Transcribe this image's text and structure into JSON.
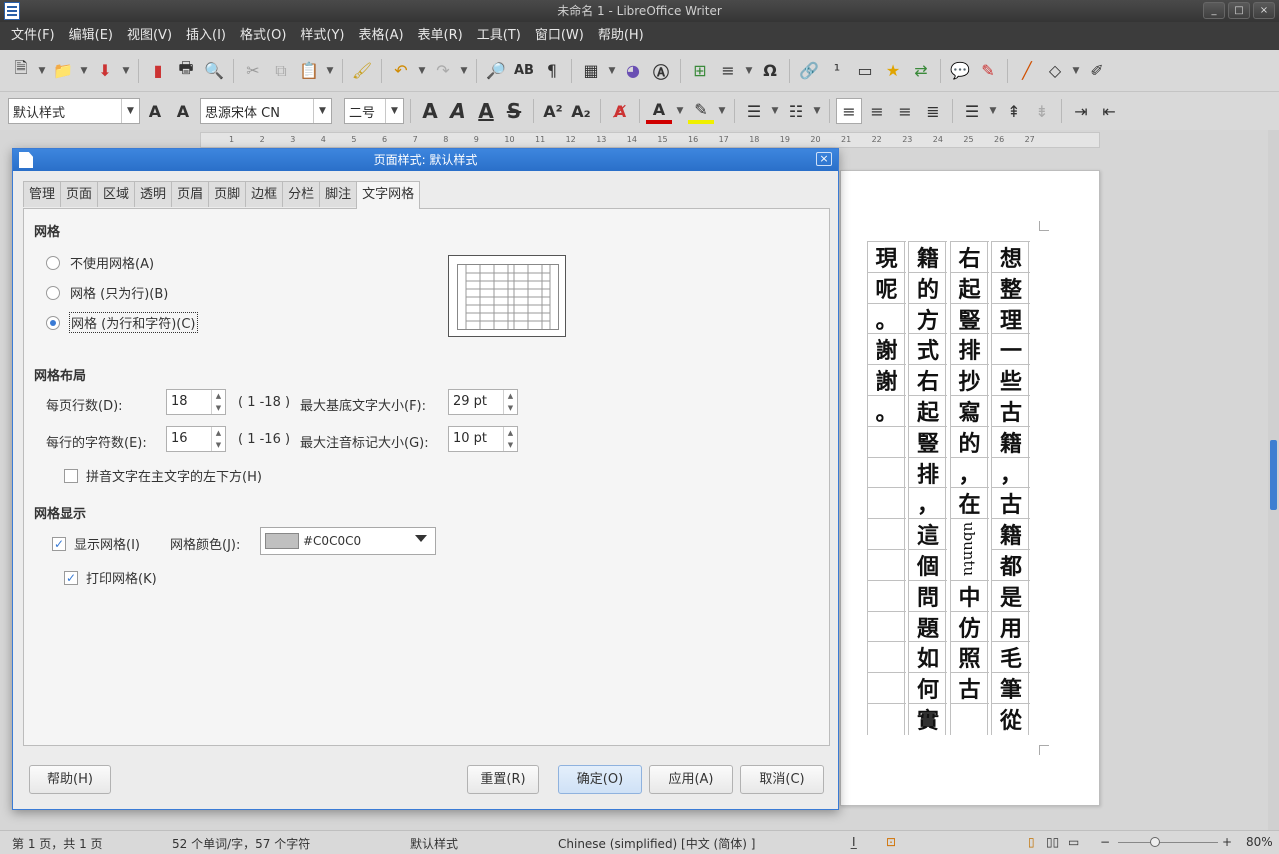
{
  "window": {
    "title": "未命名 1 - LibreOffice Writer",
    "controls": [
      "_",
      "□",
      "×"
    ]
  },
  "menubar": [
    "文件(F)",
    "编辑(E)",
    "视图(V)",
    "插入(I)",
    "格式(O)",
    "样式(Y)",
    "表格(A)",
    "表单(R)",
    "工具(T)",
    "窗口(W)",
    "帮助(H)"
  ],
  "formatbar": {
    "para_style": "默认样式",
    "font_name": "思源宋体 CN",
    "font_size": "二号"
  },
  "ruler_numbers": [
    "1",
    "2",
    "3",
    "4",
    "5",
    "6",
    "7",
    "8",
    "9",
    "10",
    "11",
    "12",
    "13",
    "14",
    "15",
    "16",
    "17",
    "18",
    "19",
    "20",
    "21",
    "22",
    "23",
    "24",
    "25",
    "26",
    "27"
  ],
  "document": {
    "columns": [
      [
        "想",
        "整",
        "理",
        "一",
        "些",
        "古",
        "籍",
        "，",
        "古",
        "籍",
        "都",
        "是",
        "用",
        "毛",
        "筆",
        "從"
      ],
      [
        "右",
        "起",
        "豎",
        "排",
        "抄",
        "寫",
        "的",
        "，",
        "在",
        "ubuntu",
        "中",
        "仿",
        "照",
        "古"
      ],
      [
        "籍",
        "的",
        "方",
        "式",
        "右",
        "起",
        "豎",
        "排",
        "，",
        "這",
        "個",
        "問",
        "題",
        "如",
        "何",
        "實"
      ],
      [
        "現",
        "呢",
        "。",
        "謝",
        "謝",
        "。"
      ]
    ]
  },
  "dialog": {
    "title": "页面样式: 默认样式",
    "close": "×",
    "tabs": [
      "管理",
      "页面",
      "区域",
      "透明",
      "页眉",
      "页脚",
      "边框",
      "分栏",
      "脚注",
      "文字网格"
    ],
    "active_tab": 9,
    "grid": {
      "section": "网格",
      "options": [
        "不使用网格(A)",
        "网格 (只为行)(B)",
        "网格 (为行和字符)(C)"
      ],
      "selected": 2
    },
    "layout": {
      "section": "网格布局",
      "lines_per_page_label": "每页行数(D):",
      "lines_per_page": "18",
      "lines_range": "( 1 -18 )",
      "max_base_size_label": "最大基底文字大小(F):",
      "max_base_size": "29 pt",
      "chars_per_line_label": "每行的字符数(E):",
      "chars_per_line": "16",
      "chars_range": "( 1 -16 )",
      "max_ruby_size_label": "最大注音标记大小(G):",
      "max_ruby_size": "10 pt",
      "ruby_below_label": "拼音文字在主文字的左下方(H)",
      "ruby_below_checked": false
    },
    "display": {
      "section": "网格显示",
      "show_grid_label": "显示网格(I)",
      "show_grid_checked": true,
      "grid_color_label": "网格颜色(J):",
      "grid_color_value": "#C0C0C0",
      "grid_color": "#c0c0c0",
      "print_grid_label": "打印网格(K)",
      "print_grid_checked": true
    },
    "buttons": {
      "help": "帮助(H)",
      "reset": "重置(R)",
      "ok": "确定(O)",
      "apply": "应用(A)",
      "cancel": "取消(C)"
    }
  },
  "statusbar": {
    "page": "第 1 页，共 1 页",
    "words": "52 个单词/字，57 个字符",
    "style": "默认样式",
    "language": "Chinese (simplified) [中文 (简体) ]",
    "zoom": "80%"
  },
  "colors": {
    "accent": "#3a7bd5",
    "menubar_bg": "#3c3c3c",
    "titlebar_bg": "#353535"
  }
}
